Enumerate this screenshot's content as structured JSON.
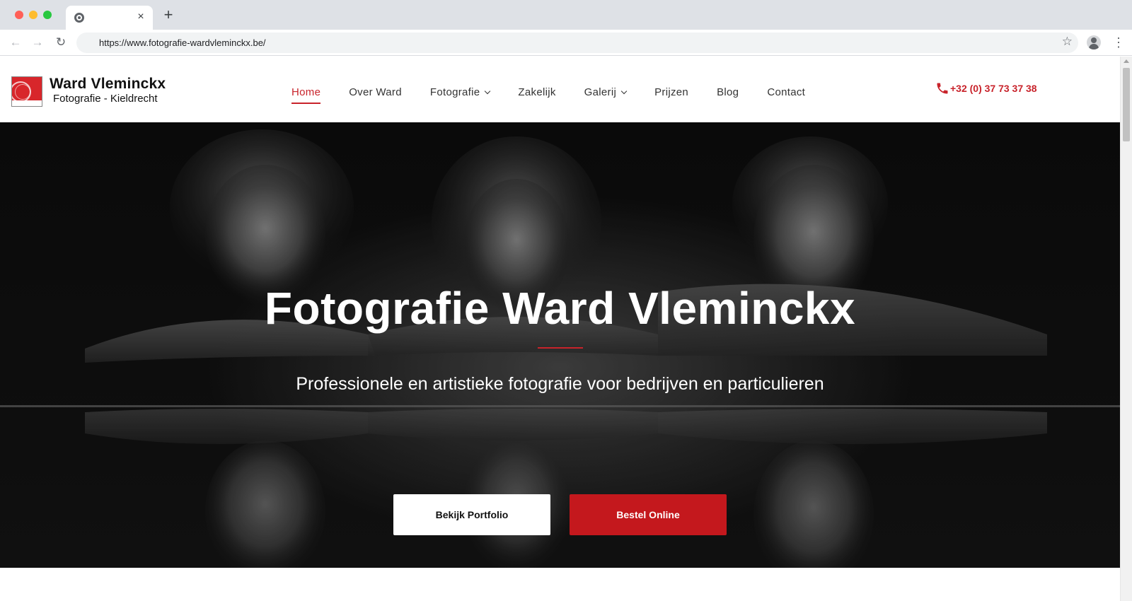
{
  "browser": {
    "url": "https://www.fotografie-wardvleminckx.be/",
    "tab_close": "×",
    "new_tab": "+"
  },
  "site": {
    "brand": {
      "title": "Ward Vleminckx",
      "subtitle": "Fotografie - Kieldrecht",
      "logo_text": "fotografie Ward Vleminckx"
    },
    "nav": {
      "items": [
        {
          "label": "Home",
          "active": true,
          "dropdown": false
        },
        {
          "label": "Over Ward",
          "active": false,
          "dropdown": false
        },
        {
          "label": "Fotografie",
          "active": false,
          "dropdown": true
        },
        {
          "label": "Zakelijk",
          "active": false,
          "dropdown": false
        },
        {
          "label": "Galerij",
          "active": false,
          "dropdown": true
        },
        {
          "label": "Prijzen",
          "active": false,
          "dropdown": false
        },
        {
          "label": "Blog",
          "active": false,
          "dropdown": false
        },
        {
          "label": "Contact",
          "active": false,
          "dropdown": false
        }
      ]
    },
    "phone": "+32 (0) 37 73 37 38"
  },
  "hero": {
    "title": "Fotografie Ward Vleminckx",
    "subtitle": "Professionele en artistieke fotografie voor bedrijven en particulieren",
    "primary_button": "Bekijk Portfolio",
    "secondary_button": "Bestel Online"
  },
  "colors": {
    "accent": "#c8232b",
    "button_red": "#c4181d",
    "hero_bg": "#111111"
  }
}
